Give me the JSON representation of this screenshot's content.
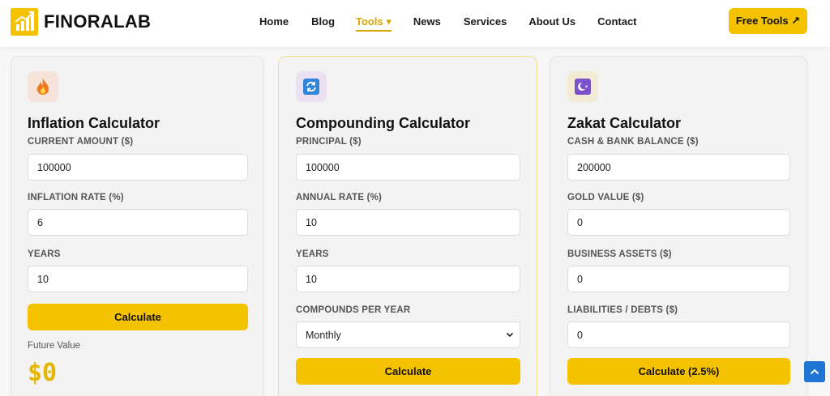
{
  "brand": {
    "name": "FINORALAB"
  },
  "nav": {
    "items": [
      {
        "label": "Home"
      },
      {
        "label": "Blog"
      },
      {
        "label": "Tools ▾"
      },
      {
        "label": "News"
      },
      {
        "label": "Services"
      },
      {
        "label": "About Us"
      },
      {
        "label": "Contact"
      }
    ],
    "active_index": 2,
    "cta": "Free Tools ↗"
  },
  "colors": {
    "accent": "#f5c200",
    "active_link": "#d9a800",
    "scroll_button": "#1f74d4"
  },
  "inflation": {
    "icon": "fire-icon",
    "title": "Inflation Calculator",
    "fields": [
      {
        "label": "CURRENT AMOUNT ($)",
        "value": "100000"
      },
      {
        "label": "INFLATION RATE (%)",
        "value": "6"
      },
      {
        "label": "YEARS",
        "value": "10"
      }
    ],
    "button": "Calculate",
    "result_label": "Future Value",
    "result_value": "$0"
  },
  "compounding": {
    "icon": "refresh-icon",
    "title": "Compounding Calculator",
    "fields": [
      {
        "label": "PRINCIPAL ($)",
        "value": "100000"
      },
      {
        "label": "ANNUAL RATE (%)",
        "value": "10"
      },
      {
        "label": "YEARS",
        "value": "10"
      }
    ],
    "select": {
      "label": "COMPOUNDS PER YEAR",
      "value": "Monthly"
    },
    "button": "Calculate"
  },
  "zakat": {
    "icon": "crescent-star-icon",
    "title": "Zakat Calculator",
    "fields": [
      {
        "label": "CASH & BANK BALANCE ($)",
        "value": "200000"
      },
      {
        "label": "GOLD VALUE ($)",
        "value": "0"
      },
      {
        "label": "BUSINESS ASSETS ($)",
        "value": "0"
      },
      {
        "label": "LIABILITIES / DEBTS ($)",
        "value": "0"
      }
    ],
    "button": "Calculate (2.5%)"
  }
}
